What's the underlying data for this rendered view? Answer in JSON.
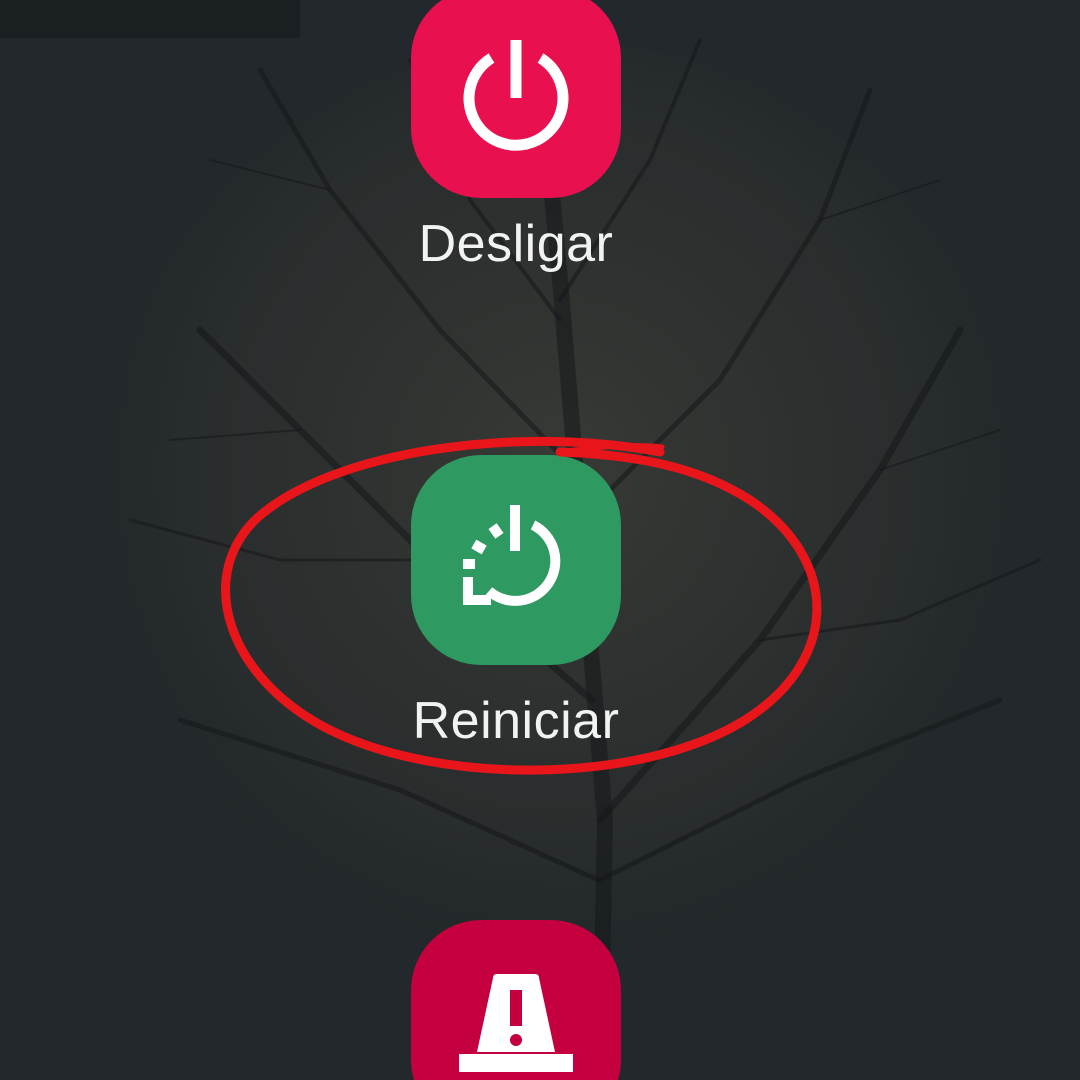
{
  "power_menu": {
    "items": [
      {
        "label": "Desligar",
        "icon": "power-icon",
        "color": "#e8104f"
      },
      {
        "label": "Reiniciar",
        "icon": "restart-icon",
        "color": "#2e9960"
      },
      {
        "label": "",
        "icon": "emergency-icon",
        "color": "#c5003e"
      }
    ]
  },
  "annotation": {
    "color": "#e8161b",
    "shape": "ellipse"
  }
}
